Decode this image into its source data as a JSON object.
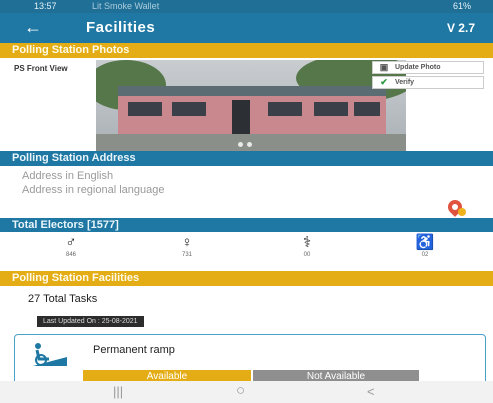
{
  "status_bar": {
    "time": "13:57",
    "carrier": "Lit Smoke Wallet",
    "battery": "61%"
  },
  "app_bar": {
    "back_icon": "arrow-left",
    "title": "Facilities",
    "version": "V 2.7"
  },
  "photos_section": {
    "header": "Polling Station Photos",
    "photo_label": "PS Front View",
    "upload_label": "Update Photo",
    "verify_label": "Verify"
  },
  "address_section": {
    "header": "Polling Station Address",
    "english_placeholder": "Address in English",
    "regional_placeholder": "Address in regional language"
  },
  "electors": {
    "header": "Total Electors [1577]",
    "items": [
      {
        "icon": "male-icon",
        "count": "846"
      },
      {
        "icon": "female-icon",
        "count": "731"
      },
      {
        "icon": "elderly-icon",
        "count": "00"
      },
      {
        "icon": "wheelchair-icon",
        "count": "02"
      }
    ]
  },
  "facilities_section": {
    "header": "Polling Station Facilities",
    "total_tasks": "27 Total Tasks",
    "last_updated": "Last Updated On : 25-08-2021",
    "card": {
      "label": "Permanent ramp",
      "available": "Available",
      "not_available": "Not Available"
    }
  },
  "nav_bar": {
    "recent": "|||",
    "home": "○",
    "back": "<"
  },
  "colors": {
    "primary": "#1f78a3",
    "accent": "#e5ad15",
    "neutral": "#8f8f8f"
  }
}
